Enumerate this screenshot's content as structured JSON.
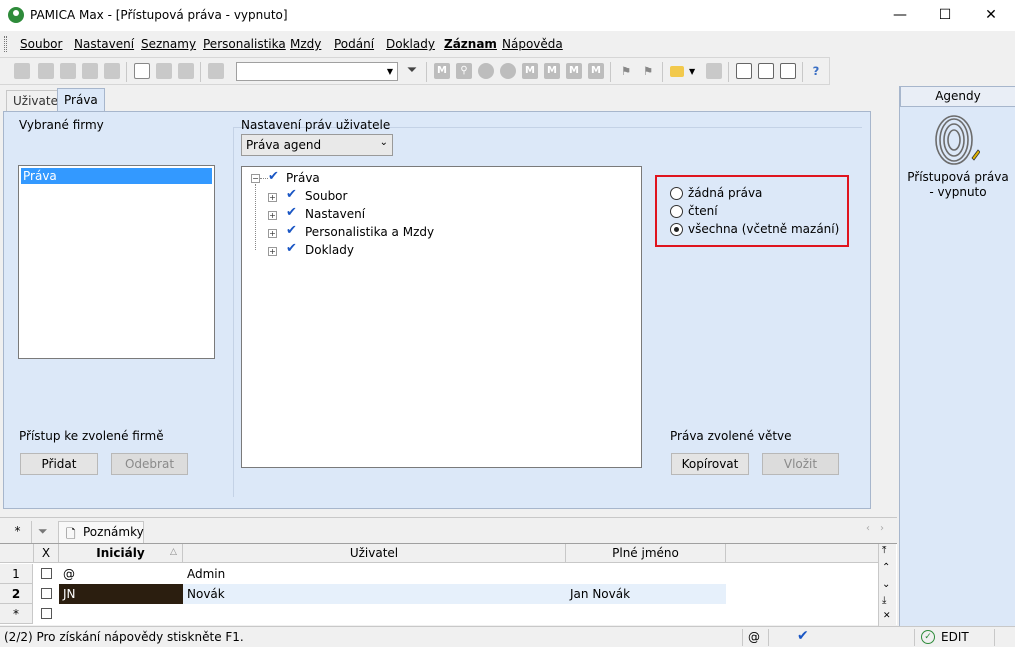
{
  "window": {
    "title": "PAMICA Max - [Přístupová práva - vypnuto]",
    "controls": {
      "minimize": "—",
      "maximize": "☐",
      "close": "✕"
    }
  },
  "menu": [
    "Soubor",
    "Nastavení",
    "Seznamy",
    "Personalistika",
    "Mzdy",
    "Podání",
    "Doklady",
    "Záznam",
    "Nápověda"
  ],
  "tabs": {
    "uzivatel": "Uživatel",
    "prava": "Práva"
  },
  "left": {
    "firms_label": "Vybrané firmy",
    "firms_items": [
      "Práva"
    ],
    "access_label": "Přístup ke zvolené firmě",
    "add_button": "Přidat",
    "remove_button": "Odebrat"
  },
  "rights": {
    "label": "Nastavení práv uživatele",
    "select_value": "Práva agend",
    "tree": {
      "root": "Práva",
      "children": [
        "Soubor",
        "Nastavení",
        "Personalistika a Mzdy",
        "Doklady"
      ]
    },
    "options": [
      "žádná práva",
      "čtení",
      "všechna (včetně mazání)"
    ],
    "selected_option": "všechna (včetně mazání)",
    "branch_label": "Práva zvolené větve",
    "copy_button": "Kopírovat",
    "paste_button": "Vložit"
  },
  "agendy": {
    "header": "Agendy",
    "item_label": "Přístupová práva - vypnuto",
    "icon": "fingerprint-icon"
  },
  "bottom": {
    "tab_star": "*",
    "tab_notes": "Poznámky",
    "columns": [
      "X",
      "Iniciály",
      "Uživatel",
      "Plné jméno"
    ],
    "rows": [
      {
        "num": "1",
        "initials": "@",
        "user": "Admin",
        "fullname": ""
      },
      {
        "num": "2",
        "initials": "JN",
        "user": "Novák",
        "fullname": "Jan Novák"
      },
      {
        "num": "*",
        "initials": "",
        "user": "",
        "fullname": ""
      }
    ]
  },
  "status": {
    "text": "(2/2) Pro získání nápovědy stiskněte F1.",
    "at": "@",
    "mode": "EDIT"
  },
  "colors": {
    "panel_bg": "#dce8f8",
    "selection": "#3399ff",
    "highlight_border": "#e0141e",
    "check_blue": "#1a56c4"
  }
}
